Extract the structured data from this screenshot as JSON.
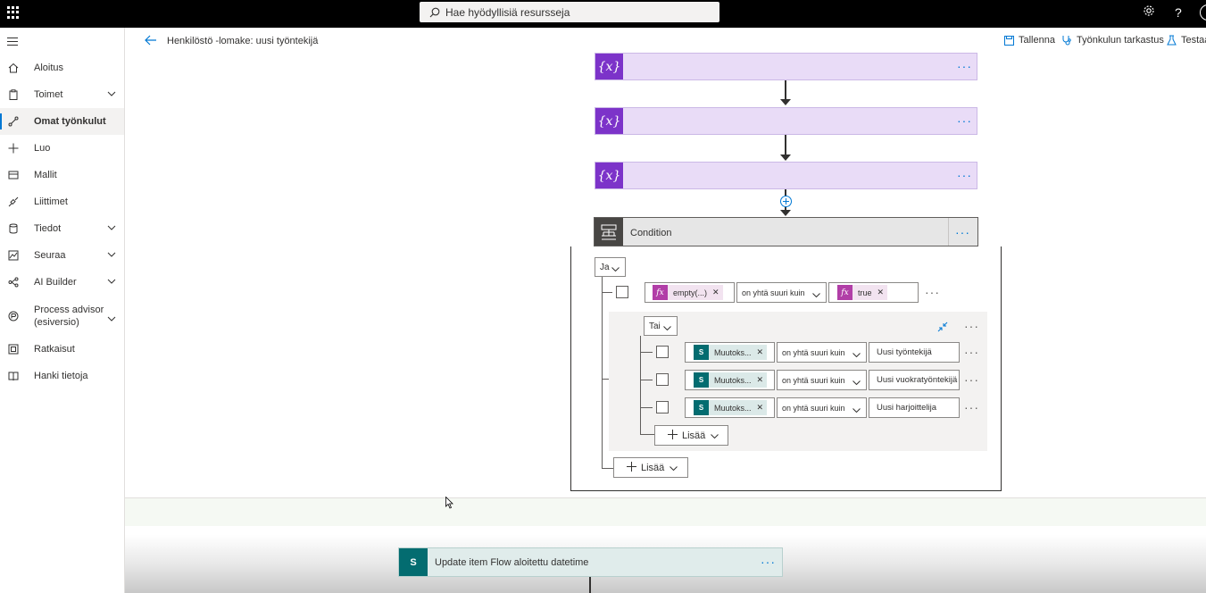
{
  "search": {
    "placeholder": "Hae hyödyllisiä resursseja"
  },
  "topbar": {
    "settings_icon": "gear-icon",
    "help_label": "?"
  },
  "sidebar": {
    "items": [
      {
        "label": "Aloitus",
        "icon": "home-icon"
      },
      {
        "label": "Toimet",
        "icon": "clipboard-icon",
        "expandable": true
      },
      {
        "label": "Omat työnkulut",
        "icon": "flow-icon",
        "active": true
      },
      {
        "label": "Luo",
        "icon": "plus-icon"
      },
      {
        "label": "Mallit",
        "icon": "template-icon"
      },
      {
        "label": "Liittimet",
        "icon": "connector-icon"
      },
      {
        "label": "Tiedot",
        "icon": "database-icon",
        "expandable": true
      },
      {
        "label": "Seuraa",
        "icon": "monitor-icon",
        "expandable": true
      },
      {
        "label": "AI Builder",
        "icon": "ai-icon",
        "expandable": true
      },
      {
        "label": "Process advisor",
        "label2": "(esiversio)",
        "icon": "process-icon",
        "expandable": true
      },
      {
        "label": "Ratkaisut",
        "icon": "solutions-icon"
      },
      {
        "label": "Hanki tietoja",
        "icon": "book-icon"
      }
    ]
  },
  "header": {
    "title": "Henkilöstö -lomake: uusi työntekijä",
    "save": "Tallenna",
    "checker": "Työnkulun tarkastus",
    "test": "Testaa"
  },
  "canvas": {
    "variable_icon_text": "{x}",
    "more": "···",
    "condition": {
      "title": "Condition",
      "root_operator": "Ja",
      "row1": {
        "left_token": "empty(...)",
        "operator": "on yhtä suuri kuin",
        "right_token": "true"
      },
      "group": {
        "operator": "Tai",
        "rows": [
          {
            "left_token": "Muutoks...",
            "operator": "on yhtä suuri kuin",
            "value": "Uusi työntekijä"
          },
          {
            "left_token": "Muutoks...",
            "operator": "on yhtä suuri kuin",
            "value": "Uusi vuokratyöntekijä"
          },
          {
            "left_token": "Muutoks...",
            "operator": "on yhtä suuri kuin",
            "value": "Uusi harjoittelija"
          }
        ],
        "add_label": "Lisää"
      },
      "add_label": "Lisää"
    },
    "update_card": {
      "title": "Update item Flow aloitettu datetime"
    }
  },
  "colors": {
    "accent": "#0078d4",
    "variable": "#7c33c9",
    "fx_token": "#b13ea7",
    "sharepoint": "#036c70"
  }
}
